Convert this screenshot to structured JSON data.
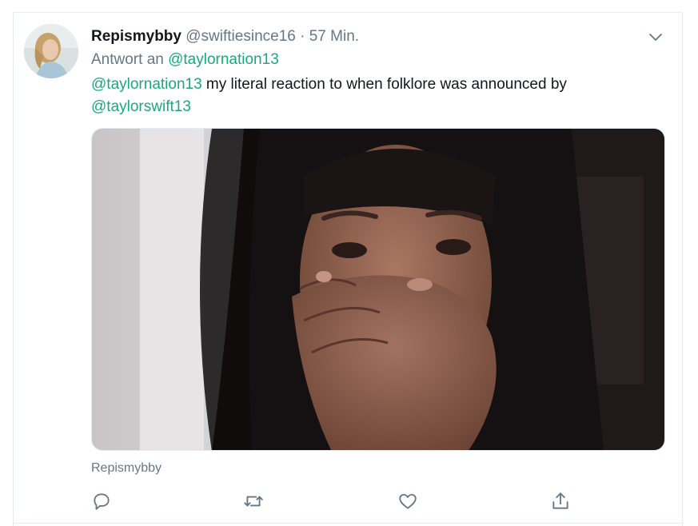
{
  "tweet": {
    "display_name": "Repismybby",
    "handle": "@swiftiesince16",
    "separator": "·",
    "time": "57 Min.",
    "reply_prefix": "Antwort an",
    "reply_to": "@taylornation13",
    "text_mention_1": "@taylornation13",
    "text_body": " my literal reaction to when folklore was announced by ",
    "text_mention_2": "@taylorswift13",
    "media_caption": "Repismybby",
    "icons": {
      "more": "chevron-down-icon",
      "reply": "reply-icon",
      "retweet": "retweet-icon",
      "like": "heart-icon",
      "share": "share-icon"
    }
  },
  "colors": {
    "link": "#19a97b",
    "text": "#14171a",
    "muted": "#657786",
    "border": "#e6ecf0"
  }
}
